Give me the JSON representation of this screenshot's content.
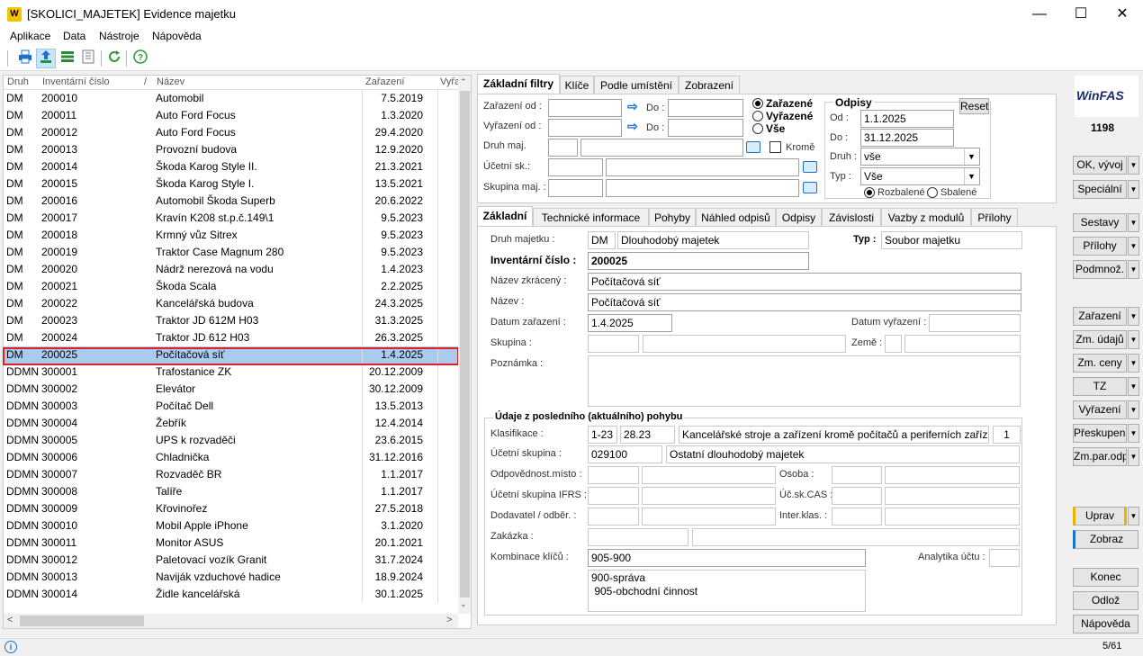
{
  "window": {
    "title": "[SKOLICI_MAJETEK] Evidence majetku",
    "logo_text": "W"
  },
  "menu": [
    "Aplikace",
    "Data",
    "Nástroje",
    "Nápověda"
  ],
  "grid": {
    "columns": {
      "druh": "Druh",
      "inv": "Inventární číslo",
      "sort_mark": "/",
      "nazev": "Název",
      "zarazeni": "Zařazení",
      "vyrazeni": "Vyřa"
    },
    "rows": [
      {
        "druh": "DM",
        "inv": "200010",
        "nazev": "Automobil",
        "dat": "7.5.2019"
      },
      {
        "druh": "DM",
        "inv": "200011",
        "nazev": "Auto Ford Focus",
        "dat": "1.3.2020"
      },
      {
        "druh": "DM",
        "inv": "200012",
        "nazev": "Auto Ford Focus",
        "dat": "29.4.2020"
      },
      {
        "druh": "DM",
        "inv": "200013",
        "nazev": "Provozní budova",
        "dat": "12.9.2020"
      },
      {
        "druh": "DM",
        "inv": "200014",
        "nazev": "Škoda Karog Style II.",
        "dat": "21.3.2021"
      },
      {
        "druh": "DM",
        "inv": "200015",
        "nazev": "Škoda Karog Style I.",
        "dat": "13.5.2021"
      },
      {
        "druh": "DM",
        "inv": "200016",
        "nazev": "Automobil Škoda Superb",
        "dat": "20.6.2022"
      },
      {
        "druh": "DM",
        "inv": "200017",
        "nazev": "Kravín K208 st.p.č.149\\1",
        "dat": "9.5.2023"
      },
      {
        "druh": "DM",
        "inv": "200018",
        "nazev": "Krmný vůz Sitrex",
        "dat": "9.5.2023"
      },
      {
        "druh": "DM",
        "inv": "200019",
        "nazev": "Traktor Case Magnum 280",
        "dat": "9.5.2023"
      },
      {
        "druh": "DM",
        "inv": "200020",
        "nazev": "Nádrž nerezová na vodu",
        "dat": "1.4.2023"
      },
      {
        "druh": "DM",
        "inv": "200021",
        "nazev": "Škoda Scala",
        "dat": "2.2.2025"
      },
      {
        "druh": "DM",
        "inv": "200022",
        "nazev": "Kancelářská budova",
        "dat": "24.3.2025"
      },
      {
        "druh": "DM",
        "inv": "200023",
        "nazev": "Traktor JD 612M H03",
        "dat": "31.3.2025"
      },
      {
        "druh": "DM",
        "inv": "200024",
        "nazev": "Traktor JD 612 H03",
        "dat": "26.3.2025"
      },
      {
        "druh": "DM",
        "inv": "200025",
        "nazev": "Počítačová síť",
        "dat": "1.4.2025"
      },
      {
        "druh": "DDMN",
        "inv": "300001",
        "nazev": "Trafostanice ZK",
        "dat": "20.12.2009"
      },
      {
        "druh": "DDMN",
        "inv": "300002",
        "nazev": "Elevátor",
        "dat": "30.12.2009"
      },
      {
        "druh": "DDMN",
        "inv": "300003",
        "nazev": "Počítač Dell",
        "dat": "13.5.2013"
      },
      {
        "druh": "DDMN",
        "inv": "300004",
        "nazev": "Žebřík",
        "dat": "12.4.2014"
      },
      {
        "druh": "DDMN",
        "inv": "300005",
        "nazev": "UPS k rozvaděči",
        "dat": "23.6.2015"
      },
      {
        "druh": "DDMN",
        "inv": "300006",
        "nazev": "Chladnička",
        "dat": "31.12.2016"
      },
      {
        "druh": "DDMN",
        "inv": "300007",
        "nazev": "Rozvaděč BR",
        "dat": "1.1.2017"
      },
      {
        "druh": "DDMN",
        "inv": "300008",
        "nazev": "Talíře",
        "dat": "1.1.2017"
      },
      {
        "druh": "DDMN",
        "inv": "300009",
        "nazev": "Křovinořez",
        "dat": "27.5.2018"
      },
      {
        "druh": "DDMN",
        "inv": "300010",
        "nazev": "Mobil Apple iPhone",
        "dat": "3.1.2020"
      },
      {
        "druh": "DDMN",
        "inv": "300011",
        "nazev": "Monitor ASUS",
        "dat": "20.1.2021"
      },
      {
        "druh": "DDMN",
        "inv": "300012",
        "nazev": "Paletovací vozík Granit",
        "dat": "31.7.2024"
      },
      {
        "druh": "DDMN",
        "inv": "300013",
        "nazev": "Naviják vzduchové hadice",
        "dat": "18.9.2024"
      },
      {
        "druh": "DDMN",
        "inv": "300014",
        "nazev": "Židle kancelářská",
        "dat": "30.1.2025"
      }
    ],
    "selected_index": 15
  },
  "filter_tabs": [
    "Základní filtry",
    "Klíče",
    "Podle umístění",
    "Zobrazení"
  ],
  "filters": {
    "zarazeni_od": "Zařazení od :",
    "vyrazeni_od": "Vyřazení od :",
    "do": "Do :",
    "druh_maj": "Druh maj.",
    "ucetni_sk": "Účetní sk.:",
    "skupina_maj": "Skupina maj. :",
    "krome": "Kromě",
    "radio": [
      "Zařazené",
      "Vyřazené",
      "Vše"
    ],
    "odpisy": {
      "title": "Odpisy",
      "reset": "Reset",
      "od_label": "Od :",
      "od": "1.1.2025",
      "do_label": "Do :",
      "do": "31.12.2025",
      "druh_label": "Druh :",
      "druh": "vše",
      "typ_label": "Typ :",
      "typ": "Vše",
      "rozbalene": "Rozbalené",
      "sbalene": "Sbalené"
    }
  },
  "detail_tabs": [
    "Základní",
    "Technické informace",
    "Pohyby",
    "Náhled odpisů",
    "Odpisy",
    "Závislosti",
    "Vazby z modulů",
    "Přílohy"
  ],
  "detail": {
    "druh_label": "Druh majetku :",
    "druh_code": "DM",
    "druh_name": "Dlouhodobý majetek",
    "typ_label": "Typ :",
    "typ": "Soubor majetku",
    "inv_label": "Inventární číslo :",
    "inv": "200025",
    "nazev_zkr_label": "Název zkrácený :",
    "nazev_zkr": "Počítačová síť",
    "nazev_label": "Název :",
    "nazev": "Počítačová síť",
    "datum_zar_label": "Datum zařazení :",
    "datum_zar": "1.4.2025",
    "datum_vyr_label": "Datum vyřazení :",
    "skupina_label": "Skupina :",
    "zeme_label": "Země :",
    "poznamka_label": "Poznámka :",
    "pohyb_title": "Údaje z posledního (aktuálního) pohybu",
    "klasifikace_label": "Klasifikace :",
    "klas1": "1-23",
    "klas2": "28.23",
    "klas_text": "Kancelářské stroje a zařízení kromě počítačů a periferních zaříz",
    "klas_n": "1",
    "ucet_sk_label": "Účetní skupina :",
    "ucet_sk": "029100",
    "ucet_sk_text": "Ostatní dlouhodobý majetek",
    "odp_misto_label": "Odpovědnost.místo :",
    "osoba_label": "Osoba :",
    "ucet_ifrs_label": "Účetní skupina IFRS :",
    "uc_cas_label": "Úč.sk.CAS :",
    "dodavatel_label": "Dodavatel / odběr. :",
    "inter_label": "Inter.klas. :",
    "zakazka_label": "Zakázka :",
    "komb_label": "Kombinace klíčů :",
    "komb": "905-900",
    "analytika_label": "Analytika účtu :",
    "komb_lines": [
      "900-správa",
      " 905-obchodní činnost"
    ]
  },
  "side": {
    "brand": "WinFAS",
    "count": "1198",
    "buttons": [
      "OK, vývoj",
      "Speciální",
      "Sestavy",
      "Přílohy",
      "Podmnož.",
      "Zařazení",
      "Zm. údajů",
      "Zm. ceny",
      "TZ",
      "Vyřazení",
      "Přeskupení",
      "Zm.par.odp",
      "Uprav",
      "Zobraz",
      "Konec",
      "Odlož",
      "Nápověda"
    ]
  },
  "status": {
    "info_icon": "info-icon",
    "position": "5/61"
  },
  "colors": {
    "selection": "#a9cbef",
    "highlight_border": "#e02020",
    "accent": "#1a6fd0"
  }
}
